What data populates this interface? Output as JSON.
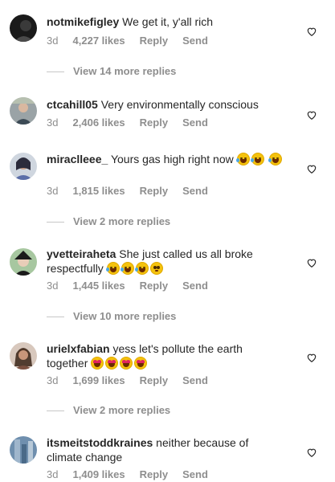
{
  "comments": [
    {
      "username": "notmikefigley",
      "text": "We get it, y'all rich",
      "age": "3d",
      "likes": "4,227 likes",
      "reply": "Reply",
      "send": "Send",
      "more_replies": "View 14 more replies"
    },
    {
      "username": "ctcahill05",
      "text": "Very environmentally conscious",
      "age": "3d",
      "likes": "2,406 likes",
      "reply": "Reply",
      "send": "Send",
      "more_replies": ""
    },
    {
      "username": "miraclleee_",
      "text": "Yours gas high right now",
      "age": "3d",
      "likes": "1,815 likes",
      "reply": "Reply",
      "send": "Send",
      "more_replies": "View 2 more replies"
    },
    {
      "username": "yvetteiraheta",
      "text": "She just called us all broke respectfully",
      "age": "3d",
      "likes": "1,445 likes",
      "reply": "Reply",
      "send": "Send",
      "more_replies": "View 10 more replies"
    },
    {
      "username": "urielxfabian",
      "text": "yess let's pollute the earth together",
      "age": "3d",
      "likes": "1,699 likes",
      "reply": "Reply",
      "send": "Send",
      "more_replies": "View 2 more replies"
    },
    {
      "username": "itsmeitstoddkraines",
      "text": "neither because of climate change",
      "age": "3d",
      "likes": "1,409 likes",
      "reply": "Reply",
      "send": "Send",
      "more_replies": ""
    }
  ],
  "icons": {
    "like": "heart-icon",
    "emoji_laugh": "tears-of-joy-emoji",
    "emoji_heart_eyes": "heart-eyes-emoji",
    "emoji_pleading": "pleading-face-emoji"
  },
  "colors": {
    "text": "#262626",
    "muted": "#8e8e8e"
  }
}
